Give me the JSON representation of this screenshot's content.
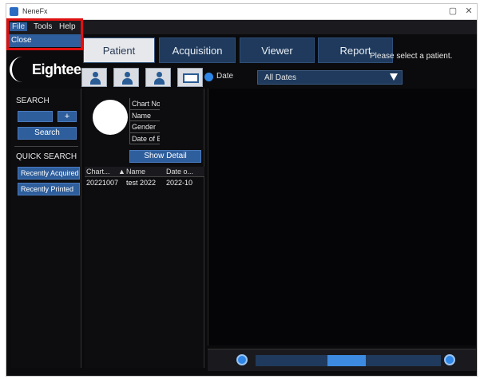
{
  "window": {
    "title": "NeneFx"
  },
  "menu": {
    "file": "File",
    "tools": "Tools",
    "help": "Help"
  },
  "file_menu": {
    "close": "Close"
  },
  "logo": {
    "text": "Eightee"
  },
  "tabs": [
    {
      "label": "Patient",
      "active": true
    },
    {
      "label": "Acquisition",
      "active": false
    },
    {
      "label": "Viewer",
      "active": false
    },
    {
      "label": "Report",
      "active": false
    }
  ],
  "status": {
    "message": "Please select a patient."
  },
  "toolbar": {
    "icons": [
      "add-patient-icon",
      "edit-patient-icon",
      "patient-info-icon",
      "id-card-icon"
    ]
  },
  "date_filter": {
    "label": "Date",
    "selected": "All Dates"
  },
  "search": {
    "title": "SEARCH",
    "plus": "+",
    "button": "Search"
  },
  "quick_search": {
    "title": "QUICK SEARCH",
    "items": [
      "Recently Acquired",
      "Recently Printed"
    ]
  },
  "patient_info": {
    "fields": [
      "Chart No.",
      "Name",
      "Gender",
      "Date of Birth"
    ],
    "detail_button": "Show Detail"
  },
  "patient_list": {
    "columns": [
      "Chart...",
      "Name",
      "Date o..."
    ],
    "rows": [
      {
        "chart": "20221007",
        "name": "test 2022",
        "date": "2022-10"
      }
    ]
  },
  "colors": {
    "accent": "#2e5e9c",
    "highlight": "#e01010",
    "background": "#0b0b0d"
  }
}
